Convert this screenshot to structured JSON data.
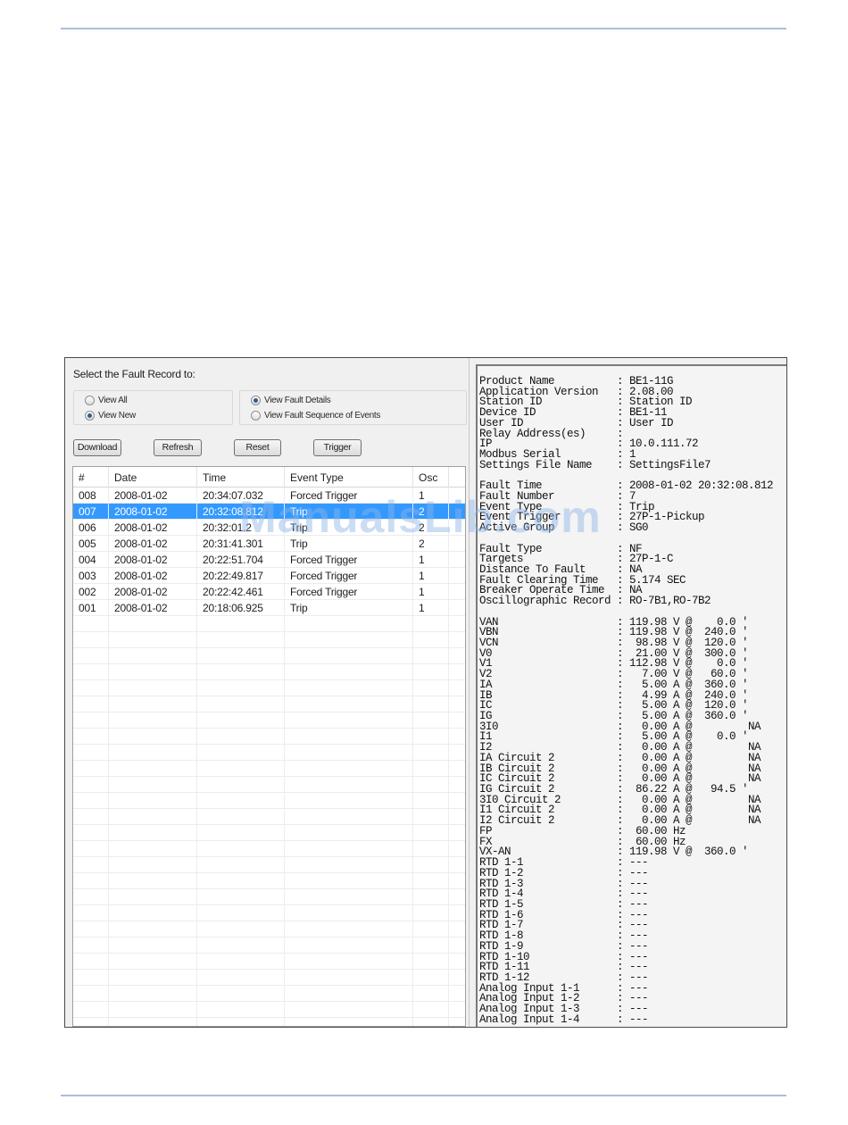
{
  "fault_window": {
    "select_label": "Select the Fault Record to:",
    "view_options": [
      {
        "label": "View All",
        "checked": false
      },
      {
        "label": "View New",
        "checked": true
      }
    ],
    "mode_options": [
      {
        "label": "View Fault Details",
        "checked": true
      },
      {
        "label": "View Fault Sequence of Events",
        "checked": false
      }
    ],
    "buttons": {
      "download": "Download",
      "refresh": "Refresh",
      "reset": "Reset",
      "trigger": "Trigger"
    },
    "table": {
      "headers": [
        "#",
        "Date",
        "Time",
        "Event Type",
        "Osc"
      ],
      "rows": [
        {
          "num": "008",
          "date": "2008-01-02",
          "time": "20:34:07.032",
          "event": "Forced Trigger",
          "osc": "1",
          "selected": false
        },
        {
          "num": "007",
          "date": "2008-01-02",
          "time": "20:32:08.812",
          "event": "Trip",
          "osc": "2",
          "selected": true
        },
        {
          "num": "006",
          "date": "2008-01-02",
          "time": "20:32:01.2",
          "event": "Trip",
          "osc": "2",
          "selected": false
        },
        {
          "num": "005",
          "date": "2008-01-02",
          "time": "20:31:41.301",
          "event": "Trip",
          "osc": "2",
          "selected": false
        },
        {
          "num": "004",
          "date": "2008-01-02",
          "time": "20:22:51.704",
          "event": "Forced Trigger",
          "osc": "1",
          "selected": false
        },
        {
          "num": "003",
          "date": "2008-01-02",
          "time": "20:22:49.817",
          "event": "Forced Trigger",
          "osc": "1",
          "selected": false
        },
        {
          "num": "002",
          "date": "2008-01-02",
          "time": "20:22:42.461",
          "event": "Forced Trigger",
          "osc": "1",
          "selected": false
        },
        {
          "num": "001",
          "date": "2008-01-02",
          "time": "20:18:06.925",
          "event": "Trip",
          "osc": "1",
          "selected": false
        }
      ]
    }
  },
  "report": {
    "lines": [
      "Product Name          : BE1-11G",
      "Application Version   : 2.08.00",
      "Station ID            : Station ID",
      "Device ID             : BE1-11",
      "User ID               : User ID",
      "Relay Address(es)     :",
      "IP                    : 10.0.111.72",
      "Modbus Serial         : 1",
      "Settings File Name    : SettingsFile7",
      "",
      "Fault Time            : 2008-01-02 20:32:08.812",
      "Fault Number          : 7",
      "Event Type            : Trip",
      "Event Trigger         : 27P-1-Pickup",
      "Active Group          : SG0",
      "",
      "Fault Type            : NF",
      "Targets               : 27P-1-C",
      "Distance To Fault     : NA",
      "Fault Clearing Time   : 5.174 SEC",
      "Breaker Operate Time  : NA",
      "Oscillographic Record : RO-7B1,RO-7B2",
      "",
      "VAN                   : 119.98 V @    0.0 '",
      "VBN                   : 119.98 V @  240.0 '",
      "VCN                   :  98.98 V @  120.0 '",
      "V0                    :  21.00 V @  300.0 '",
      "V1                    : 112.98 V @    0.0 '",
      "V2                    :   7.00 V @   60.0 '",
      "IA                    :   5.00 A @  360.0 '",
      "IB                    :   4.99 A @  240.0 '",
      "IC                    :   5.00 A @  120.0 '",
      "IG                    :   5.00 A @  360.0 '",
      "3I0                   :   0.00 A @         NA",
      "I1                    :   5.00 A @    0.0 '",
      "I2                    :   0.00 A @         NA",
      "IA Circuit 2          :   0.00 A @         NA",
      "IB Circuit 2          :   0.00 A @         NA",
      "IC Circuit 2          :   0.00 A @         NA",
      "IG Circuit 2          :  86.22 A @   94.5 '",
      "3I0 Circuit 2         :   0.00 A @         NA",
      "I1 Circuit 2          :   0.00 A @         NA",
      "I2 Circuit 2          :   0.00 A @         NA",
      "FP                    :  60.00 Hz",
      "FX                    :  60.00 Hz",
      "VX-AN                 : 119.98 V @  360.0 '",
      "RTD 1-1               : ---",
      "RTD 1-2               : ---",
      "RTD 1-3               : ---",
      "RTD 1-4               : ---",
      "RTD 1-5               : ---",
      "RTD 1-6               : ---",
      "RTD 1-7               : ---",
      "RTD 1-8               : ---",
      "RTD 1-9               : ---",
      "RTD 1-10              : ---",
      "RTD 1-11              : ---",
      "RTD 1-12              : ---",
      "Analog Input 1-1      : ---",
      "Analog Input 1-2      : ---",
      "Analog Input 1-3      : ---",
      "Analog Input 1-4      : ---"
    ]
  },
  "watermark": "ManualsLib.com",
  "colors": {
    "selection": "#3399ff",
    "rule": "#a9bde0",
    "radio_checked": "#2f5e8e"
  }
}
